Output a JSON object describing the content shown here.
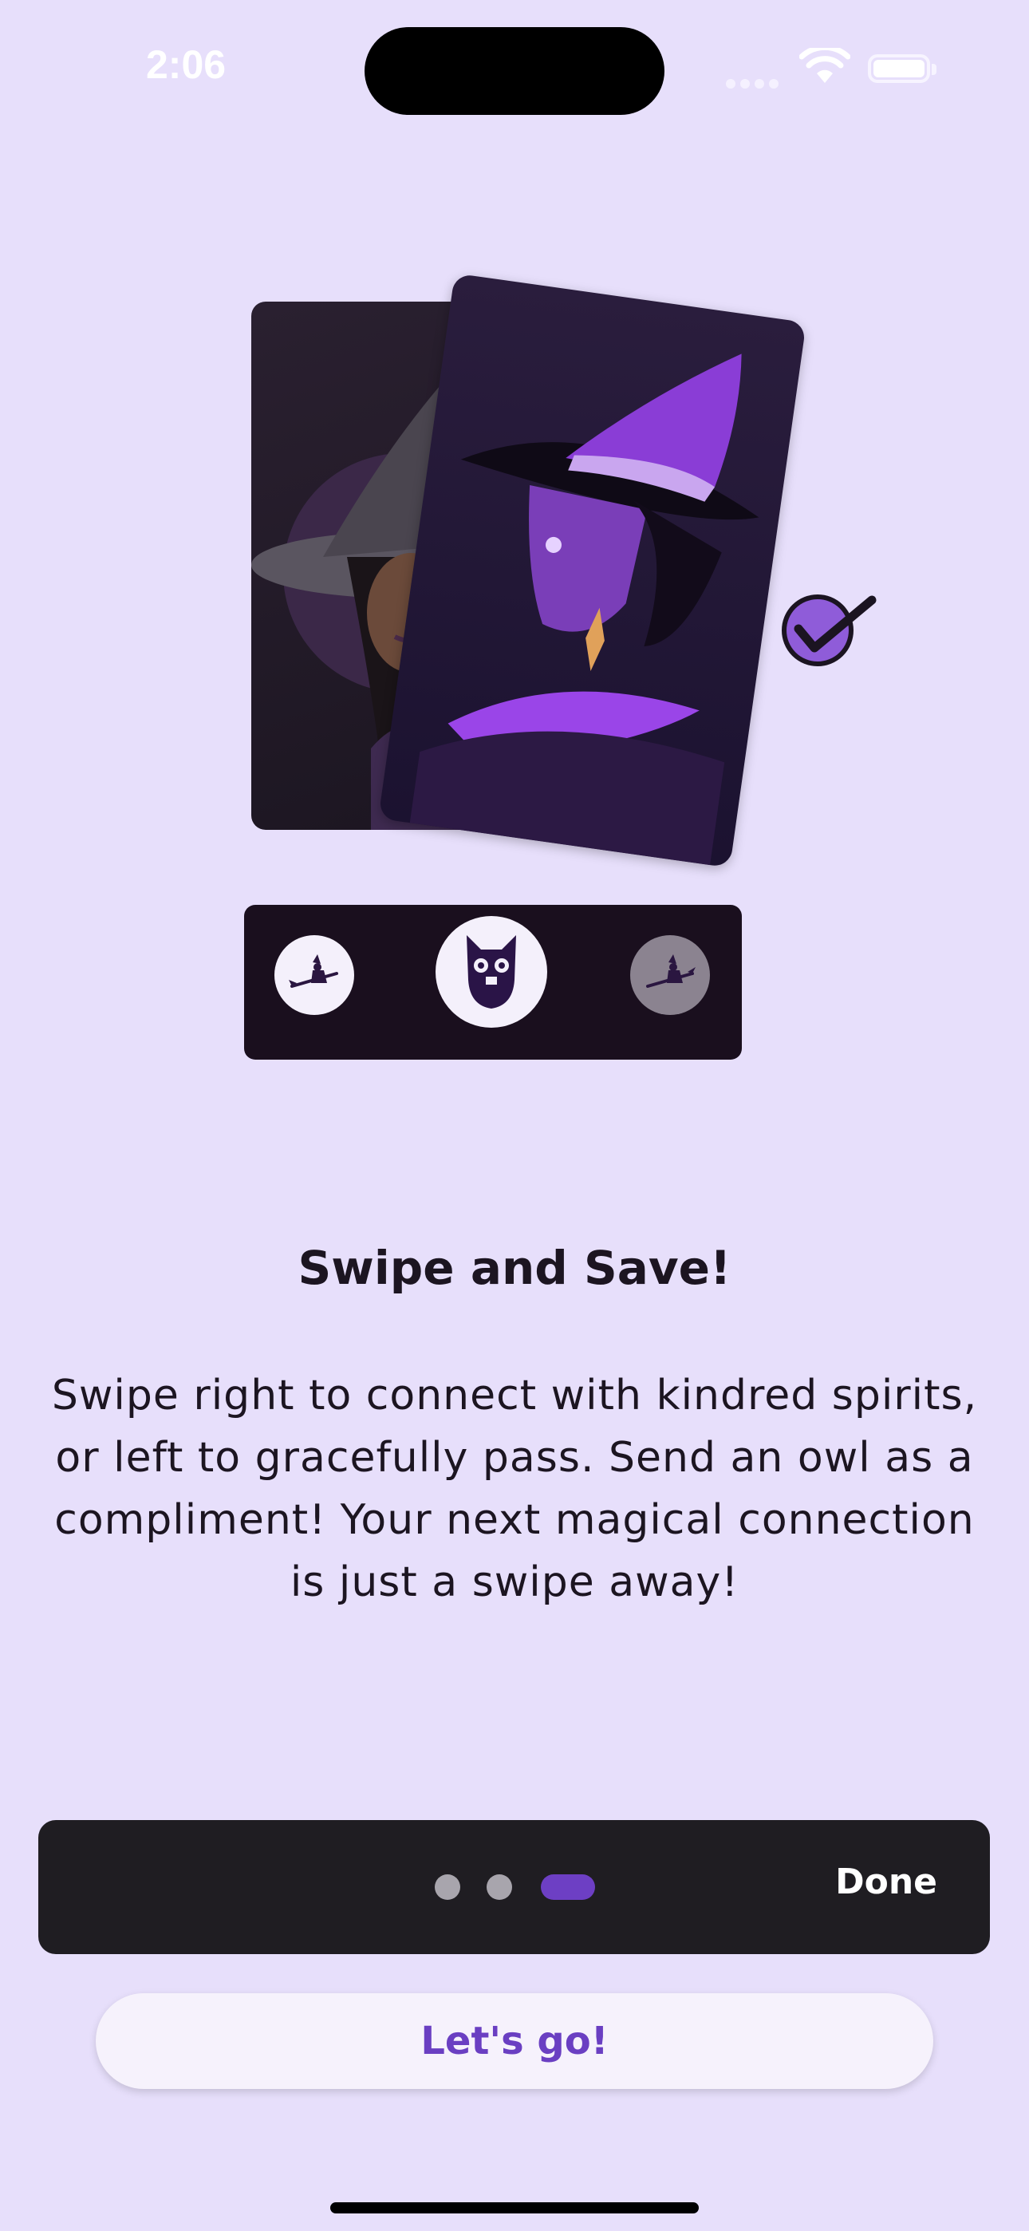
{
  "status_bar": {
    "time": "2:06"
  },
  "illustration": {
    "back_card_icon": "witch-portrait",
    "front_card_icon": "witch-portrait-purple",
    "badge_icon": "checkmark-icon"
  },
  "action_bar": {
    "left_icon": "witch-on-broom-icon",
    "center_icon": "owl-icon",
    "right_icon": "witch-on-broom-icon"
  },
  "content": {
    "title": "Swipe and Save!",
    "body": "Swipe right to connect with kindred spirits, or left to gracefully pass. Send an owl as a compliment! Your next magical connection is just a swipe away!"
  },
  "pager": {
    "page_count": 3,
    "current_page": 3,
    "done_label": "Done"
  },
  "cta": {
    "label": "Let's go!"
  },
  "colors": {
    "background": "#e7dffb",
    "accent": "#6d3fc4",
    "bar": "#1f1d22"
  }
}
